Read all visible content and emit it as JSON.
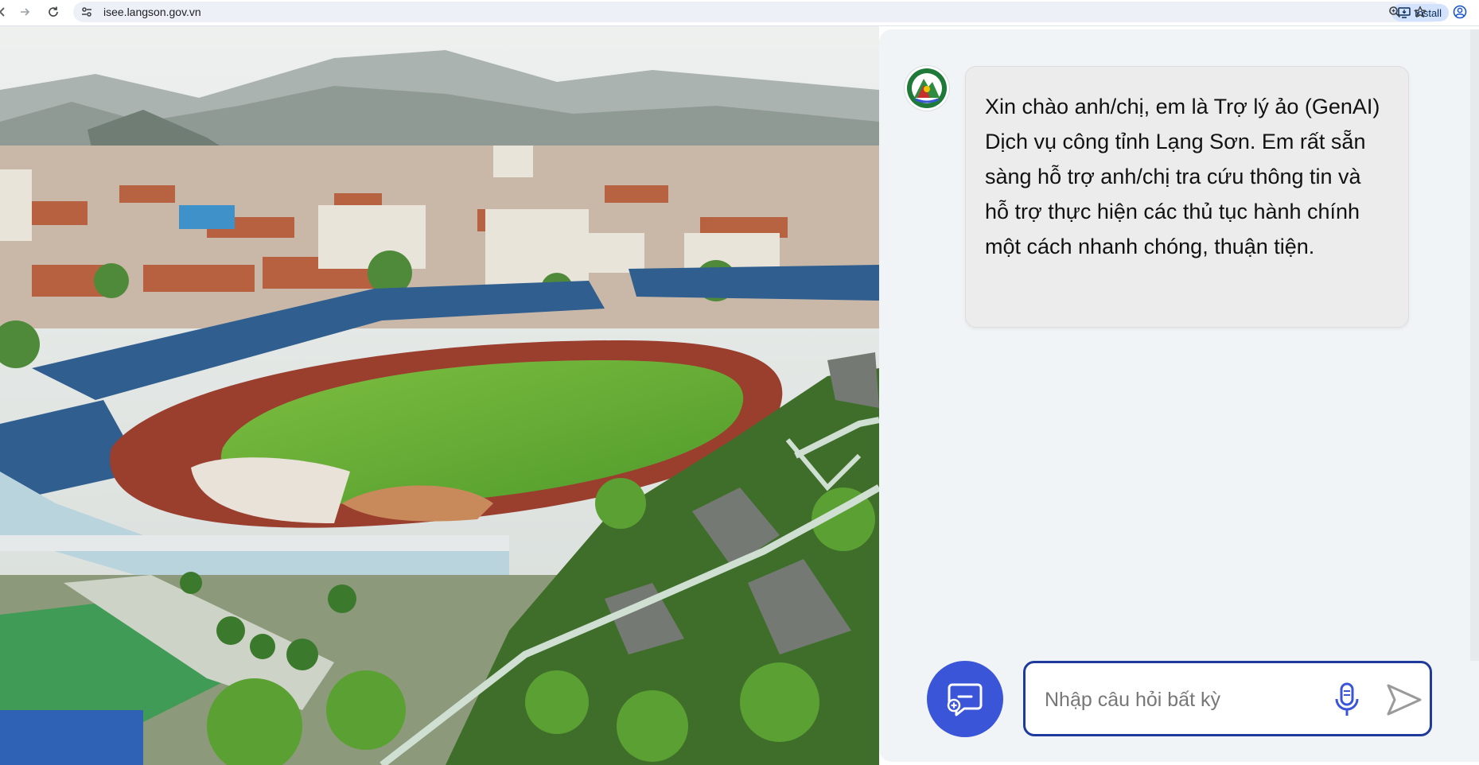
{
  "browser": {
    "url": "isee.langson.gov.vn",
    "install_label": "Install",
    "icons": [
      "back-icon",
      "forward-icon",
      "reload-icon",
      "site-info-icon",
      "install-icon",
      "zoom-icon",
      "bookmark-star-icon",
      "profile-icon"
    ]
  },
  "chat": {
    "greeting": "Xin chào anh/chị, em là Trợ lý ảo (GenAI) Dịch vụ công tỉnh Lạng Sơn. Em rất sẵn sàng hỗ trợ anh/chị tra cứu thông tin và hỗ trợ thực hiện các thủ tục hành chính một cách nhanh chóng, thuận tiện.",
    "input_placeholder": "Nhập câu hỏi bất kỳ",
    "icons": [
      "lang-son-emblem-icon",
      "new-chat-icon",
      "microphone-icon",
      "send-icon"
    ]
  },
  "colors": {
    "accent": "#3a55d8",
    "input_border": "#1d3a9c",
    "panel_background": "#f1f4f6",
    "bubble_background": "#ececec"
  }
}
